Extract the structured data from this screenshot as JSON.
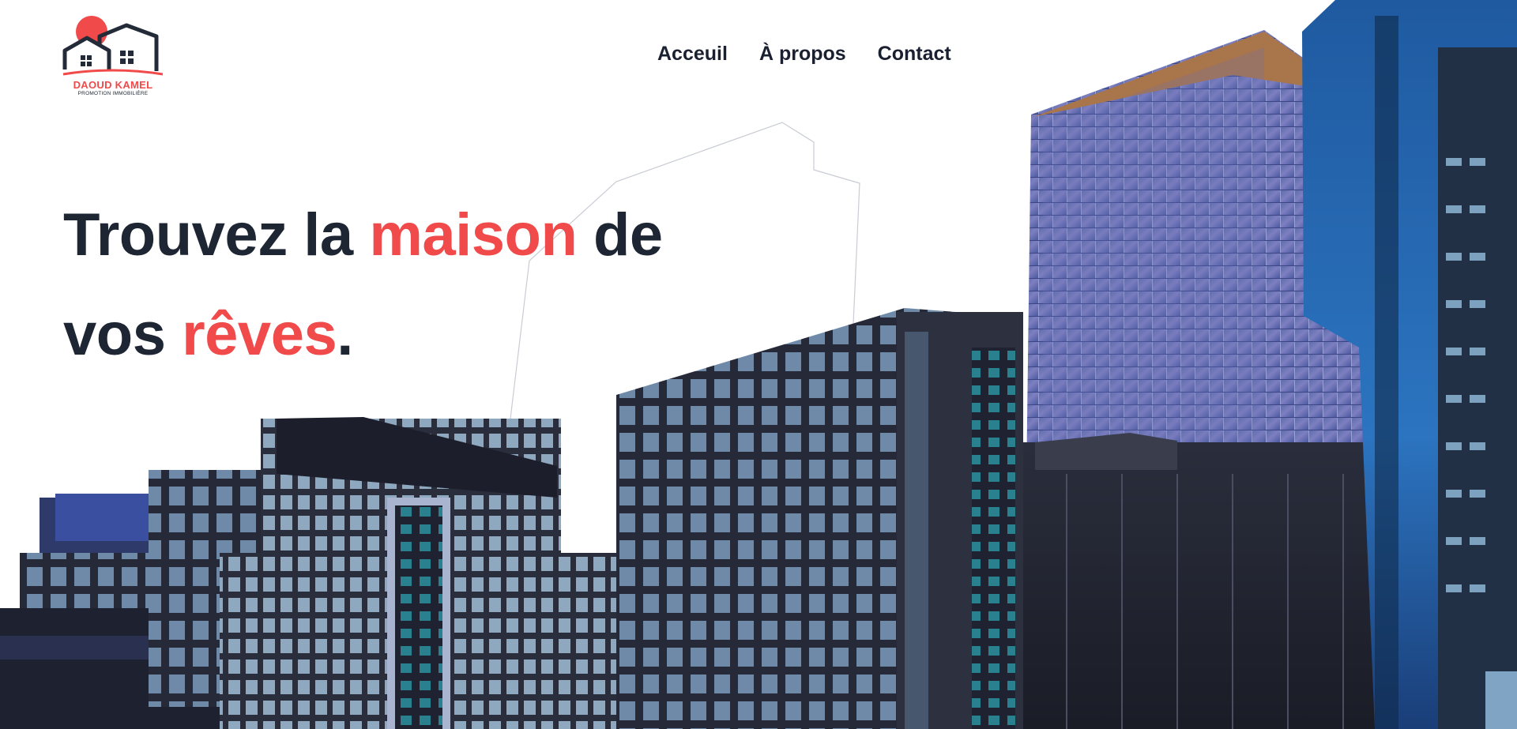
{
  "brand": {
    "name": "DAOUD KAMEL",
    "tagline": "PROMOTION IMMOBILIÈRE",
    "colors": {
      "accent": "#f04a4a",
      "dark": "#1e2533"
    }
  },
  "nav": {
    "items": [
      {
        "label": "Acceuil"
      },
      {
        "label": "À propos"
      },
      {
        "label": "Contact"
      }
    ]
  },
  "hero": {
    "headline": {
      "part1": "Trouvez la ",
      "accent1": "maison",
      "part2": " de",
      "part3": "vos ",
      "accent2": "rêves",
      "part4": "."
    },
    "background": "city-buildings-photo"
  }
}
